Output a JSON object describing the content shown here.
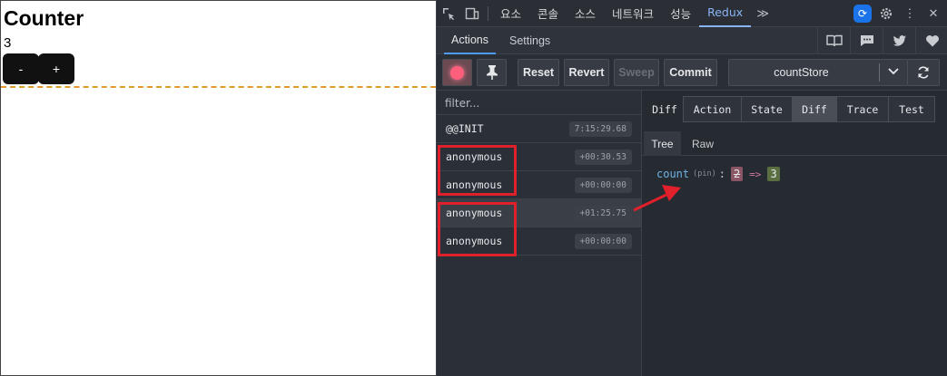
{
  "app": {
    "title": "Counter",
    "count": "3",
    "decrement_label": "-",
    "increment_label": "+"
  },
  "devtools": {
    "tabs": [
      "요소",
      "콘솔",
      "소스",
      "네트워크",
      "성능",
      "Redux"
    ],
    "active_tab": "Redux",
    "more_tabs_glyph": "≫"
  },
  "redux": {
    "subtabs": {
      "actions": "Actions",
      "settings": "Settings"
    },
    "toolbar": {
      "reset": "Reset",
      "revert": "Revert",
      "sweep": "Sweep",
      "commit": "Commit",
      "store": "countStore"
    },
    "filter_placeholder": "filter...",
    "actions": [
      {
        "name": "@@INIT",
        "time": "7:15:29.68"
      },
      {
        "name": "anonymous",
        "time": "+00:30.53"
      },
      {
        "name": "anonymous",
        "time": "+00:00:00"
      },
      {
        "name": "anonymous",
        "time": "+01:25.75"
      },
      {
        "name": "anonymous",
        "time": "+00:00:00"
      }
    ],
    "mode_label": "Diff",
    "mode_tabs": [
      "Action",
      "State",
      "Diff",
      "Trace",
      "Test"
    ],
    "active_mode": "Diff",
    "view_tabs": {
      "tree": "Tree",
      "raw": "Raw"
    },
    "diff": {
      "key": "count",
      "meta": "(pin)",
      "colon": ":",
      "old": "2",
      "arrow": "=>",
      "new": "3"
    }
  },
  "colors": {
    "annotation_red": "#e0202a",
    "dashed_line": "#e09b2d",
    "accent_blue": "#8ab4f8"
  }
}
